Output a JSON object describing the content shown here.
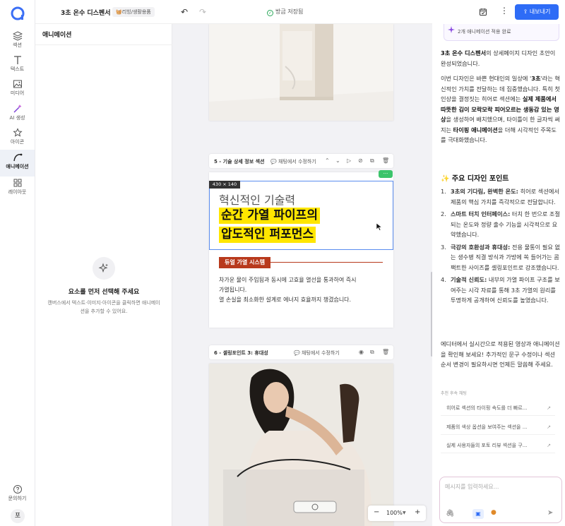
{
  "rail": {
    "items": [
      {
        "label": "섹션"
      },
      {
        "label": "텍스트"
      },
      {
        "label": "미디어"
      },
      {
        "label": "AI 생성"
      },
      {
        "label": "아이콘"
      },
      {
        "label": "애니메이션"
      },
      {
        "label": "레이아웃"
      }
    ],
    "help": "문의하기",
    "avatar": "포"
  },
  "topbar": {
    "title": "3초 온수 디스펜서",
    "category": "리빙/생활용품",
    "save_status": "방금 저장됨",
    "export_label": "내보내기"
  },
  "panel": {
    "title": "애니메이션",
    "empty_title": "요소를 먼저 선택해 주세요",
    "empty_desc": "캔버스에서 텍스트·이미지·아이콘을 클릭하면 애니메이션을 추가할 수 있어요."
  },
  "canvas": {
    "section5": {
      "name": "5 - 기술 상세 정보 섹션",
      "edit_label": "채팅에서 수정하기",
      "size_badge": "430 × 140",
      "heading_gray": "혁신적인 기술력",
      "highlight_line1": "순간 가열 파이프의",
      "highlight_line2": "압도적인 퍼포먼스",
      "tag": "듀얼 가열 시스템",
      "body_line1": "차가운 물이 주입됨과 동시에 고효율 열선을 통과하여 즉시",
      "body_line2": "가열됩니다.",
      "body_line3": "열 손실을 최소화한 설계로 에너지 효율까지 챙겼습니다."
    },
    "section6": {
      "name": "6 - 셀링포인트 3: 휴대성",
      "edit_label": "채팅에서 수정하기"
    },
    "zoom": "100%"
  },
  "chat": {
    "top_badge": "2개 애니메이션 적용 완료",
    "intro_bold": "3초 온수 디스펜서",
    "intro_rest": "의 상세페이지 디자인 초안이 완성되었습니다.",
    "p2_a": "이번 디자인은 바쁜 현대인의 일상에 '",
    "p2_b": "3초",
    "p2_c": "'라는 혁신적인 가치를 전달하는 데 집중했습니다. 특히 첫인상을 결정짓는 히어로 섹션에는 ",
    "p2_d": "실제 제품에서 따뜻한 김이 모락모락 피어오르는 생동감 있는 영상",
    "p2_e": "을 생성하여 배치했으며, 타이틀이 한 글자씩 써지는 ",
    "p2_f": "타이핑 애니메이션",
    "p2_g": "을 더해 시각적인 주목도를 극대화했습니다.",
    "heading": "✨ 주요 디자인 포인트",
    "points": [
      {
        "n": "1.",
        "bold": "3초의 기다림, 완벽한 온도:",
        "text": " 히어로 섹션에서 제품의 핵심 가치를 즉각적으로 전달합니다."
      },
      {
        "n": "2.",
        "bold": "스마트 터치 인터페이스:",
        "text": " 터치 한 번으로 조절되는 온도와 정량 출수 기능을 시각적으로 요약했습니다."
      },
      {
        "n": "3.",
        "bold": "극강의 호환성과 휴대성:",
        "text": " 전용 물통이 필요 없는 생수병 직결 방식과 가방에 쏙 들어가는 콤팩트한 사이즈를 셀링포인트로 강조했습니다."
      },
      {
        "n": "4.",
        "bold": "기술적 신뢰도:",
        "text": " 내부의 가열 파이프 구조를 보여주는 시각 자료를 통해 3초 가열의 원리를 투명하게 공개하여 신뢰도를 높였습니다."
      }
    ],
    "closing": "에디터에서 실시간으로 적용된 영상과 애니메이션을 확인해 보세요! 추가적인 문구 수정이나 섹션 순서 변경이 필요하시면 언제든 말씀해 주세요.",
    "suggest_label": "추천 후속 채팅",
    "suggestions": [
      "히어로 섹션의 타이핑 속도를 더 빠르...",
      "제품의 색상 옵션을 보여주는 섹션을 ...",
      "실제 사용자들의 포토 리뷰 섹션을 구..."
    ],
    "input_placeholder": "메시지를 입력하세요..."
  },
  "colors": {
    "accent": "#2e6cf6",
    "highlight": "#ffe600",
    "tag_bg": "#b8391c",
    "selection": "#5b8def",
    "badge_green": "#3cc46b"
  }
}
